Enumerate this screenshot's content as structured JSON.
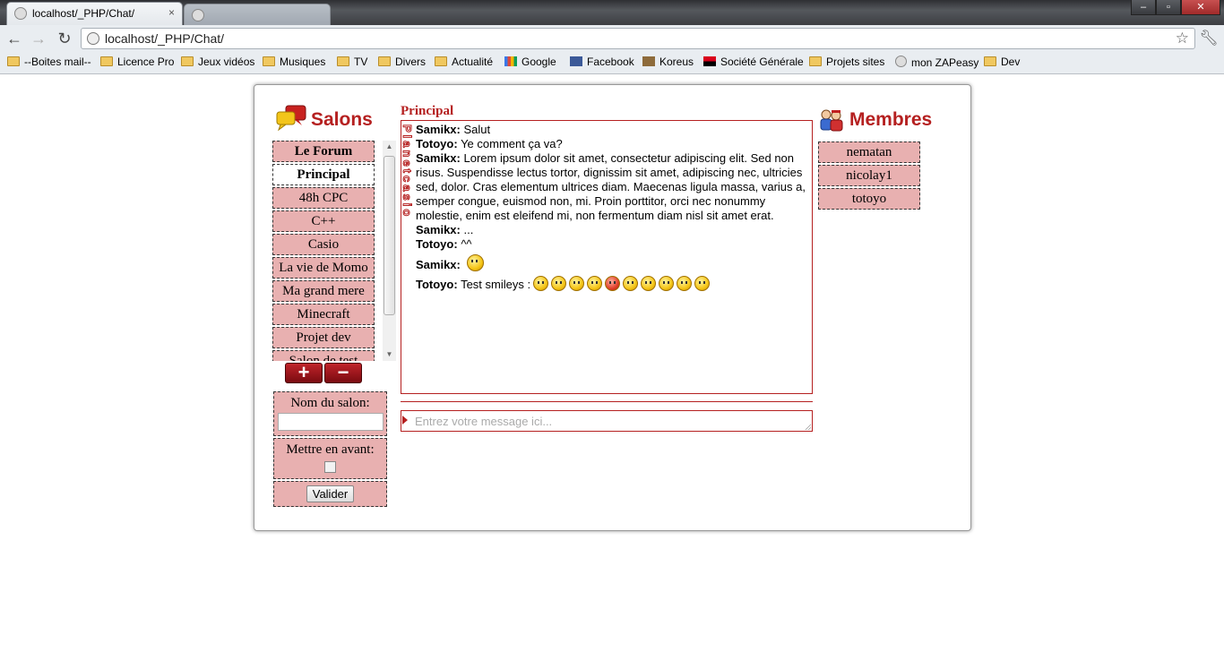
{
  "browser": {
    "tabs": [
      {
        "title": "localhost/_PHP/Chat/",
        "close": "×"
      },
      {
        "title": "",
        "close": ""
      }
    ],
    "url": "localhost/_PHP/Chat/",
    "window_buttons": [
      "–",
      "▫",
      "✕"
    ],
    "bookmarks": [
      {
        "label": "--Boites mail--",
        "icon": "folder"
      },
      {
        "label": "Licence Pro",
        "icon": "folder"
      },
      {
        "label": "Jeux vidéos",
        "icon": "folder"
      },
      {
        "label": "Musiques",
        "icon": "folder"
      },
      {
        "label": "TV",
        "icon": "folder"
      },
      {
        "label": "Divers",
        "icon": "folder"
      },
      {
        "label": "Actualité",
        "icon": "folder"
      },
      {
        "label": "Google",
        "icon": "google"
      },
      {
        "label": "Facebook",
        "icon": "fb"
      },
      {
        "label": "Koreus",
        "icon": "koreus"
      },
      {
        "label": "Société Générale",
        "icon": "sg"
      },
      {
        "label": "Projets sites",
        "icon": "folder"
      },
      {
        "label": "mon ZAPeasy",
        "icon": "globe"
      },
      {
        "label": "Dev",
        "icon": "folder"
      }
    ]
  },
  "salons": {
    "title": "Salons",
    "items": [
      {
        "label": "Le Forum"
      },
      {
        "label": "Principal"
      },
      {
        "label": "48h CPC"
      },
      {
        "label": "C++"
      },
      {
        "label": "Casio"
      },
      {
        "label": "La vie de Momo"
      },
      {
        "label": "Ma grand mere"
      },
      {
        "label": "Minecraft"
      },
      {
        "label": "Projet dev"
      },
      {
        "label": "Salon de test"
      }
    ],
    "add_label": "+",
    "remove_label": "−",
    "form": {
      "name_label": "Nom du salon:",
      "name_value": "",
      "highlight_label": "Mettre en avant:",
      "submit_label": "Valider"
    }
  },
  "chat": {
    "title": "Principal",
    "brand_vertical": "Planetcasio",
    "messages": [
      {
        "author": "Samikx:",
        "text": "Salut"
      },
      {
        "author": "Totoyo:",
        "text": "Ye comment ça va?"
      },
      {
        "author": "Samikx:",
        "text": "Lorem ipsum dolor sit amet, consectetur adipiscing elit. Sed non risus. Suspendisse lectus tortor, dignissim sit amet, adipiscing nec, ultricies sed, dolor. Cras elementum ultrices diam. Maecenas ligula massa, varius a, semper congue, euismod non, mi. Proin porttitor, orci nec nonummy molestie, enim est eleifend mi, non fermentum diam nisl sit amet erat."
      },
      {
        "author": "Samikx:",
        "text": "..."
      },
      {
        "author": "Totoyo:",
        "text": "^^"
      }
    ],
    "smiley_message": {
      "author": "Samikx:"
    },
    "smileys_message": {
      "author": "Totoyo:",
      "text": "Test smileys :"
    },
    "input_placeholder": "Entrez votre message ici..."
  },
  "membres": {
    "title": "Membres",
    "items": [
      {
        "label": "nematan"
      },
      {
        "label": "nicolay1"
      },
      {
        "label": "totoyo"
      }
    ]
  },
  "colors": {
    "accent": "#b52020",
    "item_bg": "#e8b0b0"
  }
}
